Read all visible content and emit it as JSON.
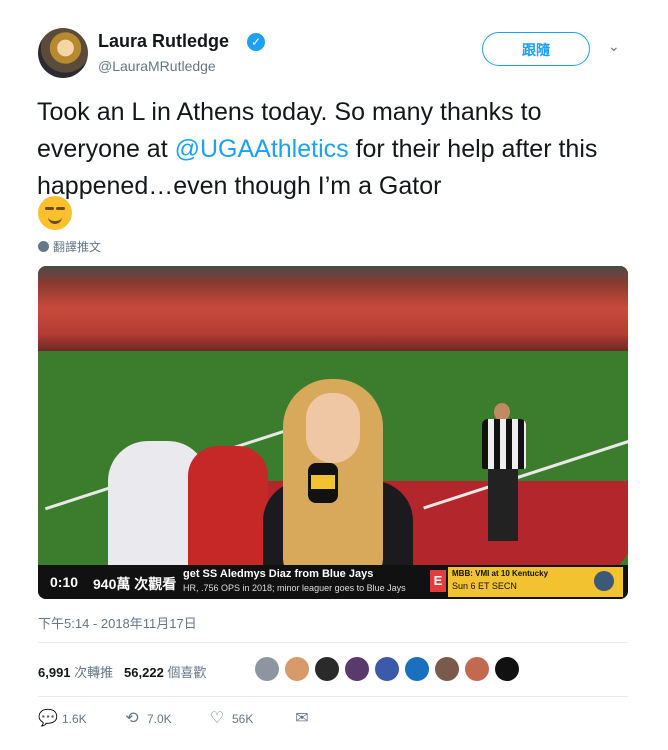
{
  "author": {
    "name": "Laura Rutledge",
    "verified_icon": "verified-badge-icon",
    "handle": "@LauraMRutledge",
    "follow_label": "跟隨"
  },
  "tweet": {
    "text_part1": "Took an L in Athens today. So many thanks to everyone at ",
    "mention": "@UGAAthletics",
    "text_part2": " for their help after this happened…even though I’m a Gator",
    "emoji": "smirking-face-emoji",
    "translate_label": "翻譯推文"
  },
  "video": {
    "time": "0:10",
    "views": "940萬 次觀看",
    "ticker_line1": "get SS Aledmys Diaz from Blue Jays",
    "ticker_line2": "HR, .756 OPS in 2018; minor leaguer goes to Blue Jays",
    "espn_label": "E",
    "score_line1": "MBB: VMI at 10 Kentucky",
    "score_line2": "Sun 6 ET SECN"
  },
  "timestamp": "下午5:14 - 2018年11月17日",
  "stats": {
    "retweets_count": "6,991",
    "retweets_label": "次轉推",
    "likes_count": "56,222",
    "likes_label": "個喜歡"
  },
  "actions": {
    "reply_count": "1.6K",
    "retweet_count": "7.0K",
    "like_count": "56K"
  },
  "colors": {
    "accent": "#1da1f2",
    "text": "#14171a",
    "muted": "#657786"
  }
}
